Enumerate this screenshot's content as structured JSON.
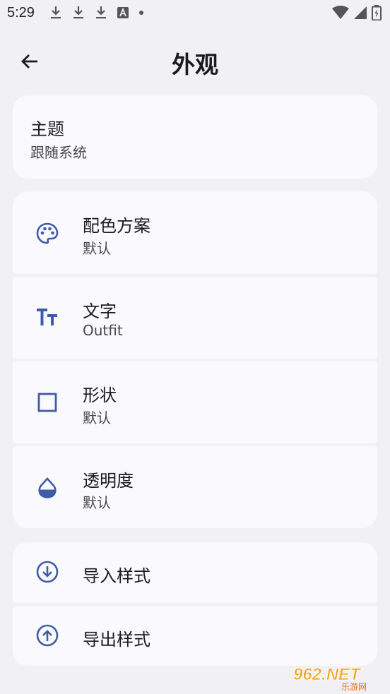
{
  "status": {
    "time": "5:29"
  },
  "header": {
    "title": "外观"
  },
  "theme": {
    "title": "主题",
    "subtitle": "跟随系统"
  },
  "appearance_items": [
    {
      "title": "配色方案",
      "subtitle": "默认",
      "icon": "palette-icon"
    },
    {
      "title": "文字",
      "subtitle": "Outfit",
      "icon": "text-fields-icon"
    },
    {
      "title": "形状",
      "subtitle": "默认",
      "icon": "square-outline-icon"
    },
    {
      "title": "透明度",
      "subtitle": "默认",
      "icon": "opacity-drop-icon"
    }
  ],
  "style_actions": [
    {
      "title": "导入样式",
      "icon": "download-circle-icon"
    },
    {
      "title": "导出样式",
      "icon": "upload-circle-icon"
    }
  ],
  "watermark": {
    "text": "962.NET",
    "sub": "乐游网"
  },
  "colors": {
    "accent": "#3f5ba9",
    "background": "#f1f0f5",
    "card": "#fafafe"
  }
}
